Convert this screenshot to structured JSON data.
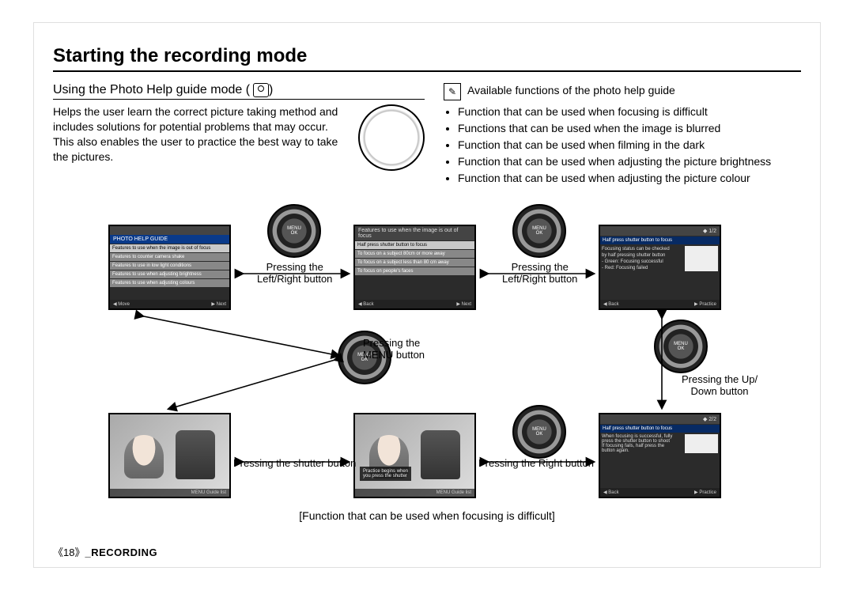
{
  "header": {
    "title": "Starting the recording mode"
  },
  "section": {
    "subhead": "Using the Photo Help guide mode (",
    "subhead_close": ")",
    "body": "Helps the user learn the correct picture taking method and includes solutions for potential problems that may occur. This also enables the user to practice the best way to take the pictures."
  },
  "note": {
    "label": "Available functions of the photo help guide",
    "items": [
      "Function that can be used when focusing is difficult",
      "Functions that can be used when the image is blurred",
      "Function that can be used when filming in the dark",
      "Function that can be used when adjusting the picture brightness",
      "Function that can be used when adjusting the picture colour"
    ]
  },
  "diagram": {
    "labels": {
      "lr1": "Pressing the\nLeft/Right  button",
      "lr2": "Pressing the\nLeft/Right  button",
      "menu": "Pressing the\nMENU button",
      "updown": "Pressing the Up/\nDown  button",
      "shutter": "Pressing the shutter button",
      "right": "Pressing the Right button"
    },
    "screens": {
      "s1": {
        "header": "PHOTO HELP GUIDE",
        "rowSel": "Features to use when the image is out of focus",
        "rows": [
          "Features to counter camera shake",
          "Features to use in low light conditions",
          "Features to use when adjusting brightness",
          "Features to use when adjusting colours"
        ],
        "footLeft": "Move",
        "footRight": "Next"
      },
      "s2": {
        "barTitle": "Features to use when the image is out of focus",
        "rowSel": "Half press shutter button to focus",
        "rows": [
          "To focus on a subject 80cm or more away",
          "To focus on a subject less than 80 cm away",
          "To focus on people's faces"
        ],
        "footLeft": "Back",
        "footRight": "Next"
      },
      "s3": {
        "page": "1/2",
        "rowSel": "Half press shutter button to focus",
        "body": [
          "Focusing status can be checked",
          "by half pressing shutter button",
          "- Green: Focusing successful",
          "- Red: Focusing failed"
        ],
        "footLeft": "Back",
        "footRight": "Practice"
      },
      "s4": {
        "footLabel": "MENU  Guide list"
      },
      "s5": {
        "overlay": [
          "Practice begins when",
          "you press the shutter"
        ],
        "footLabel": "MENU  Guide list"
      },
      "s6": {
        "page": "2/2",
        "rowSel": "Half press shutter button to focus",
        "body": [
          "When focusing is successful, fully",
          "press the shutter button to shoot",
          "If focusing fails, half press the",
          "button again."
        ],
        "footLeft": "Back",
        "footRight": "Practice"
      }
    },
    "caption": "[Function that can be used when focusing is difficult]"
  },
  "footer": {
    "page": "《18》",
    "label": "_RECORDING"
  }
}
